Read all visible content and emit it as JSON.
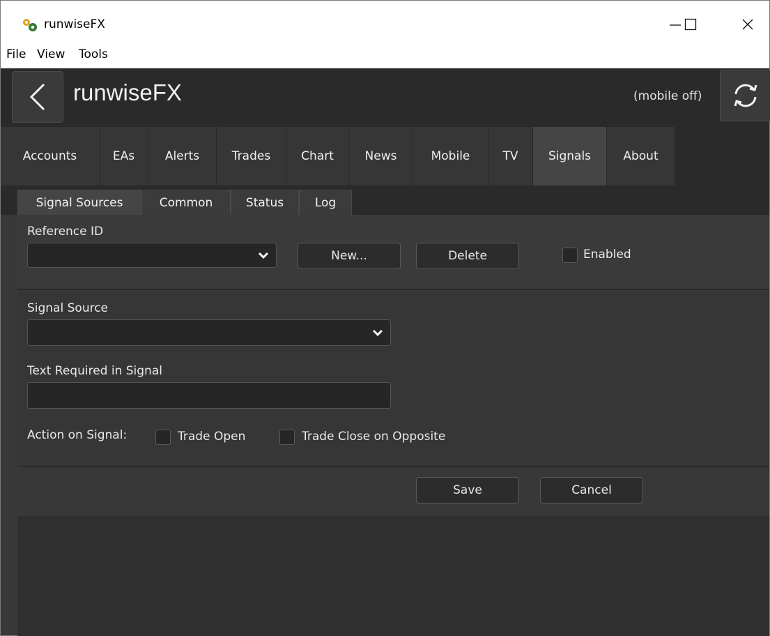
{
  "window": {
    "title": "runwiseFX",
    "minimize": "—",
    "maximize": "☐",
    "close": "✕"
  },
  "menu": [
    "File",
    "View",
    "Tools"
  ],
  "header": {
    "app_name": "runwiseFX",
    "mobile_status": "(mobile off)"
  },
  "tabs": [
    "Accounts",
    "EAs",
    "Alerts",
    "Trades",
    "Chart",
    "News",
    "Mobile",
    "TV",
    "Signals",
    "About"
  ],
  "active_tab": "Signals",
  "subtabs": [
    "Signal Sources",
    "Common",
    "Status",
    "Log"
  ],
  "active_subtab": "Signal Sources",
  "reference": {
    "label": "Reference ID",
    "selected": "",
    "new_label": "New...",
    "delete_label": "Delete",
    "enabled_label": "Enabled",
    "enabled_checked": false
  },
  "source": {
    "signal_source_label": "Signal Source",
    "signal_source_value": "",
    "text_required_label": "Text Required in Signal",
    "text_required_value": "",
    "action_label": "Action on Signal:",
    "trade_open_label": "Trade Open",
    "trade_open_checked": false,
    "trade_close_label": "Trade Close on Opposite",
    "trade_close_checked": false
  },
  "footer": {
    "save_label": "Save",
    "cancel_label": "Cancel"
  }
}
